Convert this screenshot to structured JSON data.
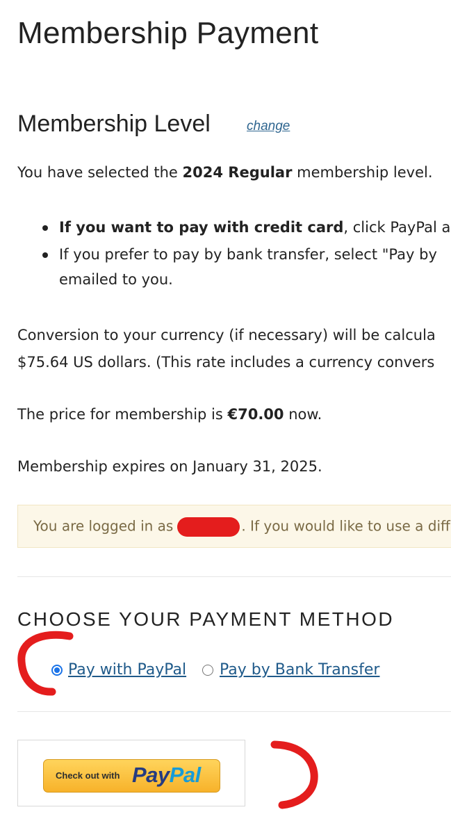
{
  "page": {
    "title": "Membership Payment"
  },
  "level": {
    "heading": "Membership Level",
    "change_link": "change",
    "selected_prefix": "You have selected the ",
    "selected_level": "2024 Regular",
    "selected_suffix": " membership level."
  },
  "instructions": [
    {
      "bold": "If you want to pay with credit card",
      "text": ", click PayPal a"
    },
    {
      "bold": "",
      "text": "If you prefer to pay by bank transfer, select \"Pay by"
    },
    {
      "bold": "",
      "text": "emailed to you."
    }
  ],
  "conversion": {
    "line1": "Conversion to your currency (if necessary) will be calcula",
    "line2": "$75.64 US dollars. (This rate includes a currency convers"
  },
  "price": {
    "prefix": "The price for membership is ",
    "amount": "€70.00",
    "suffix": " now."
  },
  "expiry": {
    "text": "Membership expires on January 31, 2025."
  },
  "notice": {
    "prefix": "You are logged in as",
    "suffix": ". If you would like to use a differ",
    "redaction_color": "#e41d1d"
  },
  "payment": {
    "heading": "CHOOSE YOUR PAYMENT METHOD",
    "options": [
      {
        "label": "Pay with PayPal",
        "selected": true
      },
      {
        "label": "Pay by Bank Transfer",
        "selected": false
      }
    ]
  },
  "checkout": {
    "prefix": "Check out with",
    "logo_pay": "Pay",
    "logo_pal": "Pal"
  },
  "colors": {
    "link": "#1f5a8a",
    "notice_bg": "#fcf7e8",
    "paypal_gold": "#f7b22a",
    "annotation_red": "#e41d1d"
  }
}
